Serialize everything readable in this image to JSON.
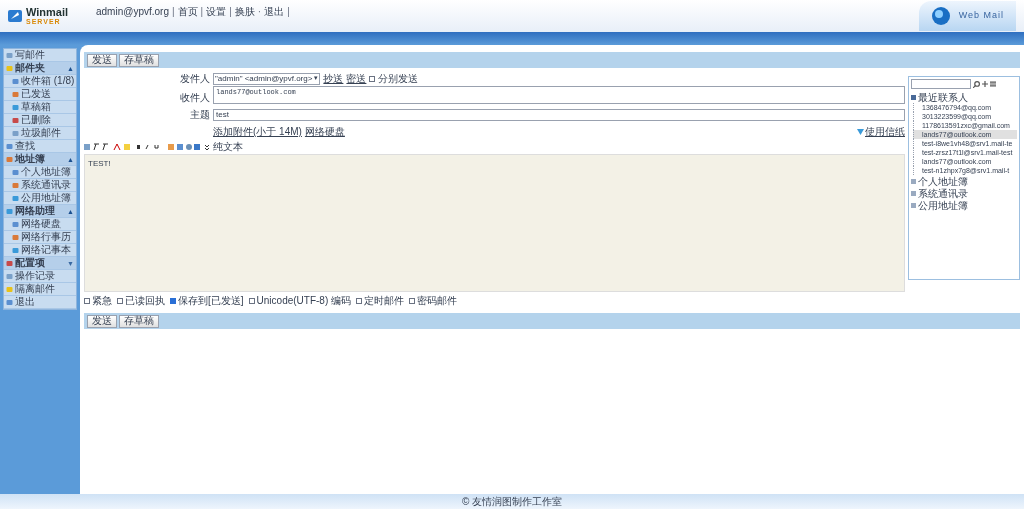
{
  "header": {
    "user": "admin@ypvf.org",
    "links": [
      {
        "sep": "|",
        "text": "首页"
      },
      {
        "sep": "|",
        "text": "设置"
      },
      {
        "sep": "|",
        "text": "换肤"
      },
      {
        "sep": "·",
        "text": "退出"
      }
    ],
    "trailing": "|",
    "brand": "Web Mail",
    "logo": "Winmail",
    "logo_sub": "SERVER"
  },
  "sidebar": {
    "items": [
      {
        "label": "写邮件",
        "kind": "item"
      },
      {
        "label": "邮件夹",
        "kind": "group",
        "expanded": true,
        "toggle": "▲",
        "children": [
          {
            "label": "收件箱 (1/8)"
          },
          {
            "label": "已发送"
          },
          {
            "label": "草稿箱"
          },
          {
            "label": "已删除"
          },
          {
            "label": "垃圾邮件"
          }
        ]
      },
      {
        "label": "查找",
        "kind": "item"
      },
      {
        "label": "地址簿",
        "kind": "group",
        "expanded": true,
        "toggle": "▲",
        "children": [
          {
            "label": "个人地址簿"
          },
          {
            "label": "系统通讯录"
          },
          {
            "label": "公用地址簿"
          }
        ]
      },
      {
        "label": "网络助理",
        "kind": "group",
        "expanded": true,
        "toggle": "▲",
        "children": [
          {
            "label": "网络硬盘"
          },
          {
            "label": "网络行事历"
          },
          {
            "label": "网络记事本"
          }
        ]
      },
      {
        "label": "配置项",
        "kind": "group",
        "expanded": false,
        "toggle": "▼"
      },
      {
        "label": "操作记录",
        "kind": "item"
      },
      {
        "label": "隔离邮件",
        "kind": "item"
      },
      {
        "label": "退出",
        "kind": "item"
      }
    ]
  },
  "top_buttons": [
    "发送",
    "存草稿"
  ],
  "form": {
    "from_label": "发件人",
    "from_value": "\"admin\" <admin@ypvf.org>",
    "from_arrow": "▾",
    "cc": "抄送",
    "bcc": "密送",
    "separate": {
      "label": "分别发送",
      "checked": false
    },
    "to_label": "收件人",
    "to_value": "lands77@outlook.com",
    "subject_label": "主题",
    "subject_value": "test",
    "attach": "添加附件(小于 14M)",
    "netdisk": "网络硬盘",
    "stationery": "使用信纸",
    "plain_text": "纯文本",
    "body": "TEST!"
  },
  "options": [
    {
      "label": "紧急",
      "checked": false
    },
    {
      "label": "已读回执",
      "checked": false
    },
    {
      "label": "保存到[已发送]",
      "checked": true
    },
    {
      "label": "Unicode(UTF-8) 编码",
      "checked": false
    },
    {
      "label": "定时邮件",
      "checked": false
    },
    {
      "label": "密码邮件",
      "checked": false
    }
  ],
  "bottom_buttons": [
    "发送",
    "存草稿"
  ],
  "contacts": {
    "groups": [
      {
        "label": "最近联系人",
        "expanded": true,
        "children": [
          {
            "label": "1368476794@qq.com",
            "selected": false
          },
          {
            "label": "3013223599@qq.com",
            "selected": false
          },
          {
            "label": "1178613591zxc@gmail.com",
            "selected": false
          },
          {
            "label": "lands77@outlook.com",
            "selected": true
          },
          {
            "label": "test-i8we1vh48@srv1.mail-te",
            "selected": false
          },
          {
            "label": "test-zrsz17t1l@srv1.mail-test",
            "selected": false
          },
          {
            "label": "lands77@outlook.com",
            "selected": false
          },
          {
            "label": "test-n1zhpx7g8@srv1.mail-t",
            "selected": false
          }
        ]
      },
      {
        "label": "个人地址簿",
        "expanded": false
      },
      {
        "label": "系统通讯录",
        "expanded": false
      },
      {
        "label": "公用地址簿",
        "expanded": false
      }
    ]
  },
  "footer": "© 友情润图制作工作室"
}
